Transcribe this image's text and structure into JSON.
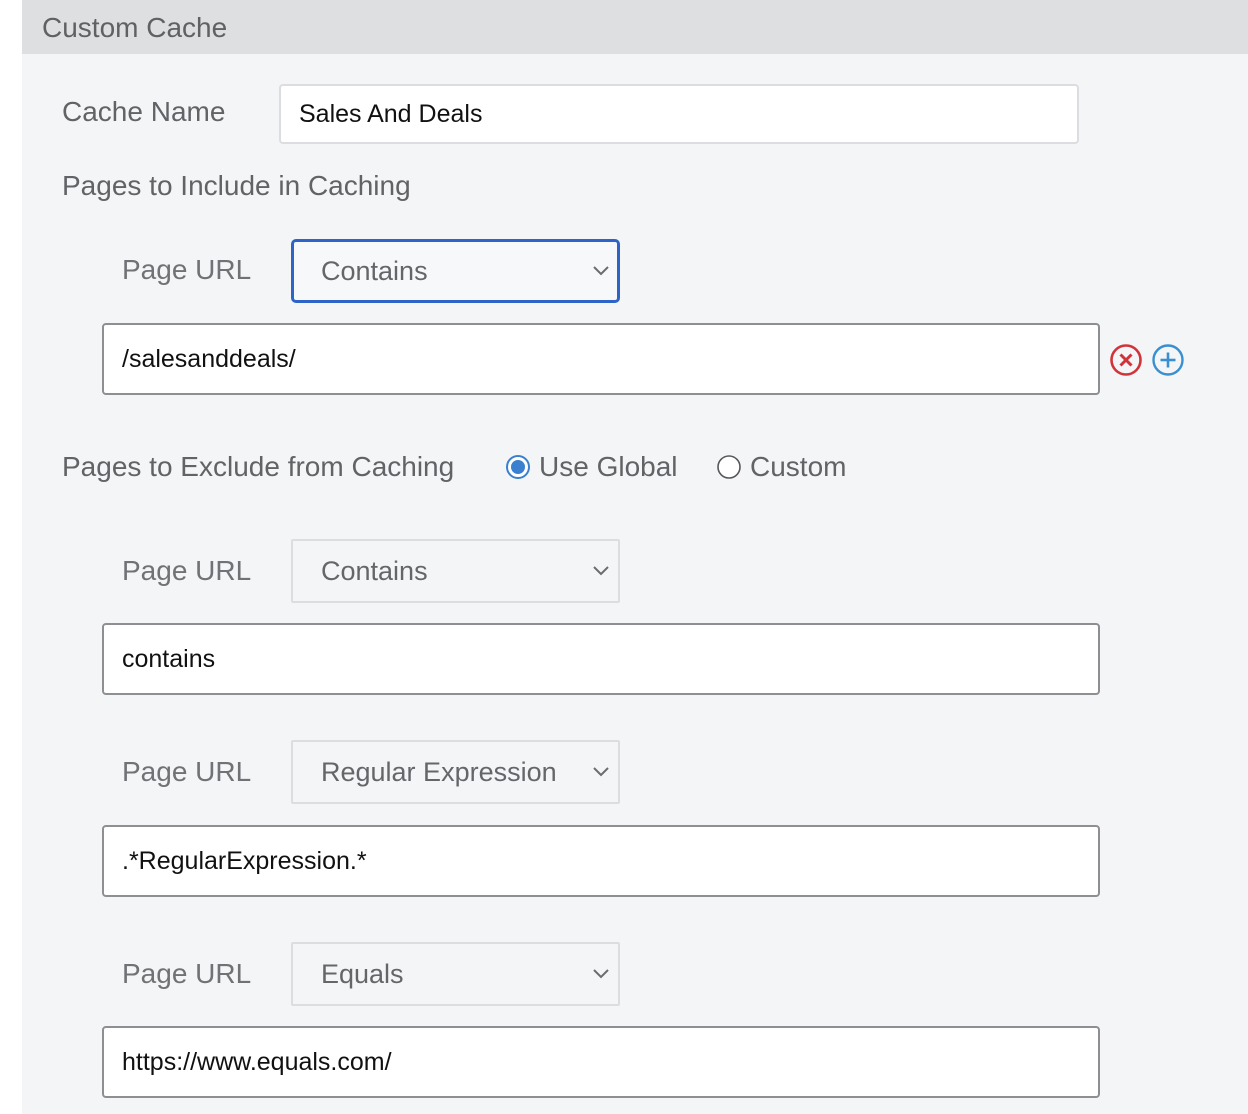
{
  "panel": {
    "title": "Custom Cache"
  },
  "cache_name": {
    "label": "Cache Name",
    "value": "Sales And Deals"
  },
  "include": {
    "heading": "Pages to Include in Caching",
    "rules": [
      {
        "label": "Page URL",
        "match": "Contains",
        "value": "/salesanddeals/"
      }
    ],
    "icons": [
      "remove-circle-icon",
      "add-circle-icon"
    ],
    "icon_colors": {
      "remove": "#d0343a",
      "add": "#3a8fd0"
    }
  },
  "exclude": {
    "heading": "Pages to Exclude from Caching",
    "options": [
      {
        "label": "Use Global",
        "selected": true
      },
      {
        "label": "Custom",
        "selected": false
      }
    ],
    "rules": [
      {
        "label": "Page URL",
        "match": "Contains",
        "value": "contains"
      },
      {
        "label": "Page URL",
        "match": "Regular Expression",
        "value": ".*RegularExpression.*"
      },
      {
        "label": "Page URL",
        "match": "Equals",
        "value": "https://www.equals.com/"
      }
    ]
  },
  "colors": {
    "focus_border": "#2e64c8",
    "radio_selected": "#3a7fd0"
  }
}
